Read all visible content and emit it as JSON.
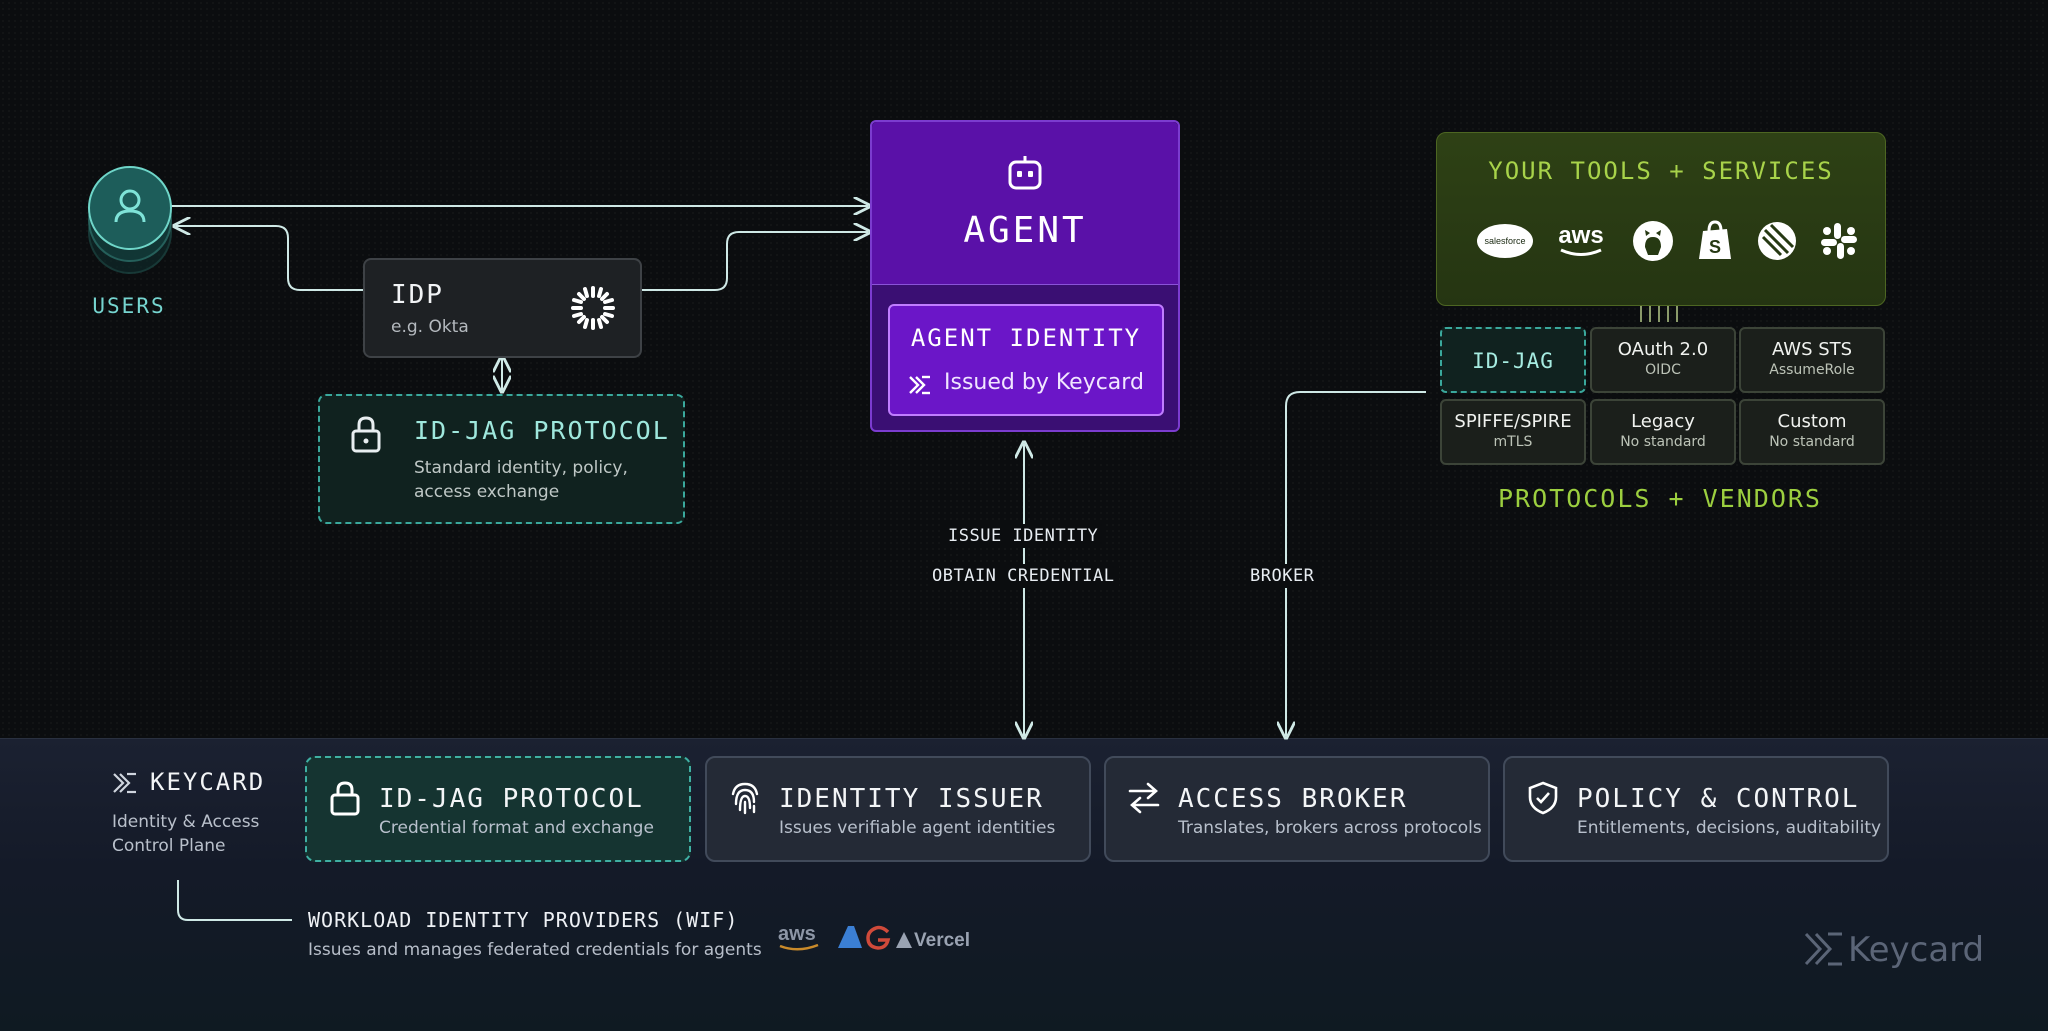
{
  "users": {
    "label": "USERS"
  },
  "idp": {
    "title": "IDP",
    "subtitle": "e.g. Okta"
  },
  "jag_protocol": {
    "title": "ID-JAG PROTOCOL",
    "subtitle": "Standard identity, policy, access exchange"
  },
  "agent": {
    "title": "AGENT",
    "identity_title": "AGENT IDENTITY",
    "identity_sub": "Issued by Keycard"
  },
  "tools": {
    "title": "YOUR TOOLS + SERVICES",
    "logos": [
      "salesforce",
      "aws",
      "github",
      "shopify",
      "linear",
      "slack"
    ]
  },
  "protocols": {
    "label": "PROTOCOLS + VENDORS",
    "items": [
      {
        "title": "ID-JAG",
        "sub": ""
      },
      {
        "title": "OAuth 2.0",
        "sub": "OIDC"
      },
      {
        "title": "AWS STS",
        "sub": "AssumeRole"
      },
      {
        "title": "SPIFFE/SPIRE",
        "sub": "mTLS"
      },
      {
        "title": "Legacy",
        "sub": "No standard"
      },
      {
        "title": "Custom",
        "sub": "No standard"
      }
    ]
  },
  "flow": {
    "issue_identity": "ISSUE IDENTITY",
    "obtain_credential": "OBTAIN CREDENTIAL",
    "broker": "BROKER"
  },
  "keycard": {
    "brand": "KEYCARD",
    "subtitle": "Identity & Access Control Plane"
  },
  "cards": [
    {
      "title": "ID-JAG PROTOCOL",
      "sub": "Credential format and exchange",
      "icon": "lock-icon"
    },
    {
      "title": "IDENTITY ISSUER",
      "sub": "Issues verifiable agent identities",
      "icon": "fingerprint-icon"
    },
    {
      "title": "ACCESS BROKER",
      "sub": "Translates, brokers across protocols",
      "icon": "swap-arrows-icon"
    },
    {
      "title": "POLICY & CONTROL",
      "sub": "Entitlements, decisions, auditability",
      "icon": "shield-check-icon"
    }
  ],
  "wif": {
    "title": "WORKLOAD IDENTITY PROVIDERS (WIF)",
    "subtitle": "Issues and manages federated credentials for agents",
    "logos": [
      "aws",
      "azure",
      "google",
      "Vercel"
    ]
  },
  "watermark": "Keycard",
  "colors": {
    "accent_teal": "#76d5d0",
    "agent_purple": "#5a11a8",
    "tools_green": "#a8d34a"
  }
}
